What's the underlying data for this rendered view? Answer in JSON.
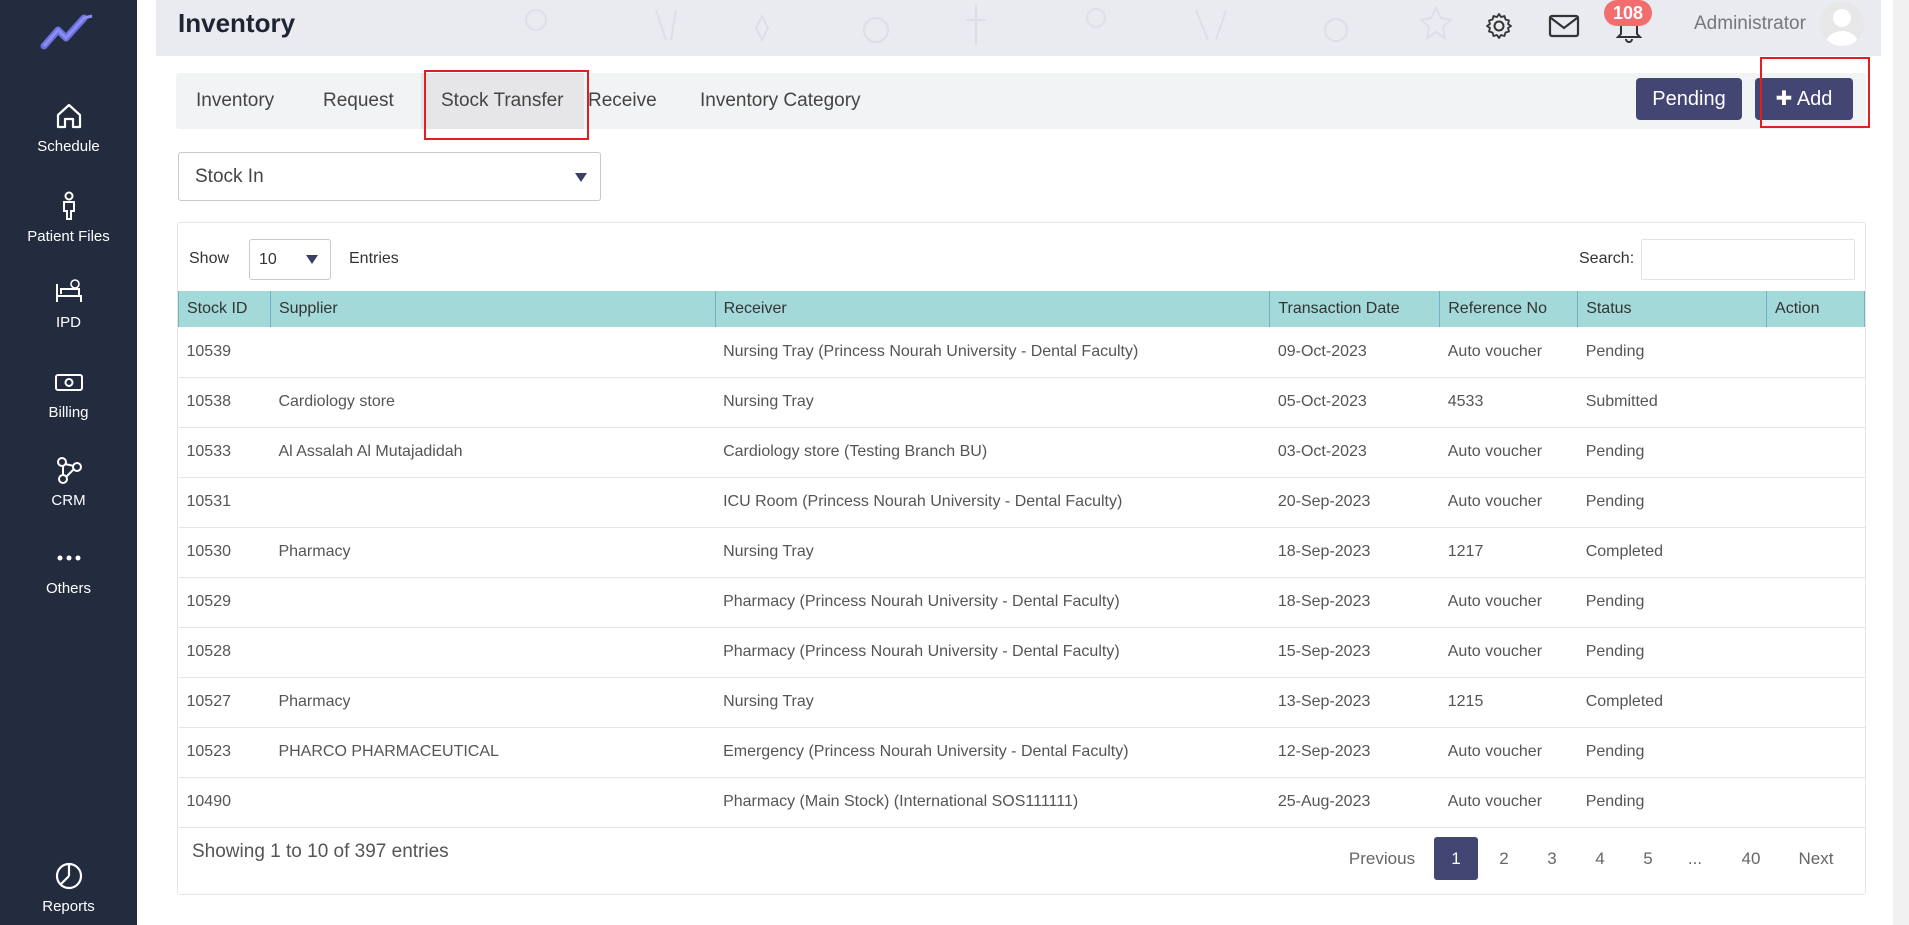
{
  "app": {
    "title": "Inventory"
  },
  "colors": {
    "sidebar": "#232b3e",
    "accent": "#434573",
    "table_header": "#a3d9d9",
    "badge": "#f26d6d",
    "highlight": "#e0201f"
  },
  "sidebar": {
    "items": [
      {
        "label": "Schedule",
        "icon": "home-icon"
      },
      {
        "label": "Patient Files",
        "icon": "person-icon"
      },
      {
        "label": "IPD",
        "icon": "bed-icon"
      },
      {
        "label": "Billing",
        "icon": "money-icon"
      },
      {
        "label": "CRM",
        "icon": "network-icon"
      },
      {
        "label": "Others",
        "icon": "more-dots-icon"
      },
      {
        "label": "Reports",
        "icon": "pie-chart-icon"
      }
    ]
  },
  "header": {
    "notifications_count": "108",
    "user_name": "Administrator"
  },
  "tabs": [
    {
      "label": "Inventory"
    },
    {
      "label": "Request"
    },
    {
      "label": "Stock Transfer",
      "active": true
    },
    {
      "label": "Receive"
    },
    {
      "label": "Inventory Category"
    }
  ],
  "actions": {
    "pending_label": "Pending",
    "add_label": "Add"
  },
  "filter": {
    "selected": "Stock In"
  },
  "table_controls": {
    "show_label": "Show",
    "entries_value": "10",
    "entries_label": "Entries",
    "search_label": "Search:"
  },
  "table": {
    "columns": [
      "Stock ID",
      "Supplier",
      "Receiver",
      "Transaction Date",
      "Reference No",
      "Status",
      "Action"
    ],
    "rows": [
      [
        "10539",
        "",
        "Nursing Tray (Princess Nourah University - Dental Faculty)",
        "09-Oct-2023",
        "Auto voucher",
        "Pending",
        ""
      ],
      [
        "10538",
        "Cardiology store",
        "Nursing Tray",
        "05-Oct-2023",
        "4533",
        "Submitted",
        ""
      ],
      [
        "10533",
        "Al Assalah Al Mutajadidah",
        "Cardiology store (Testing Branch BU)",
        "03-Oct-2023",
        "Auto voucher",
        "Pending",
        ""
      ],
      [
        "10531",
        "",
        "ICU Room (Princess Nourah University - Dental Faculty)",
        "20-Sep-2023",
        "Auto voucher",
        "Pending",
        ""
      ],
      [
        "10530",
        "Pharmacy",
        "Nursing Tray",
        "18-Sep-2023",
        "1217",
        "Completed",
        ""
      ],
      [
        "10529",
        "",
        "Pharmacy (Princess Nourah University - Dental Faculty)",
        "18-Sep-2023",
        "Auto voucher",
        "Pending",
        ""
      ],
      [
        "10528",
        "",
        "Pharmacy (Princess Nourah University - Dental Faculty)",
        "15-Sep-2023",
        "Auto voucher",
        "Pending",
        ""
      ],
      [
        "10527",
        "Pharmacy",
        "Nursing Tray",
        "13-Sep-2023",
        "1215",
        "Completed",
        ""
      ],
      [
        "10523",
        "PHARCO PHARMACEUTICAL",
        "Emergency (Princess Nourah University - Dental Faculty)",
        "12-Sep-2023",
        "Auto voucher",
        "Pending",
        ""
      ],
      [
        "10490",
        "",
        "Pharmacy (Main Stock) (International SOS111111)",
        "25-Aug-2023",
        "Auto voucher",
        "Pending",
        ""
      ]
    ]
  },
  "pagination": {
    "summary": "Showing 1 to 10 of 397 entries",
    "previous": "Previous",
    "pages": [
      "1",
      "2",
      "3",
      "4",
      "5",
      "...",
      "40"
    ],
    "next": "Next",
    "current": "1"
  }
}
